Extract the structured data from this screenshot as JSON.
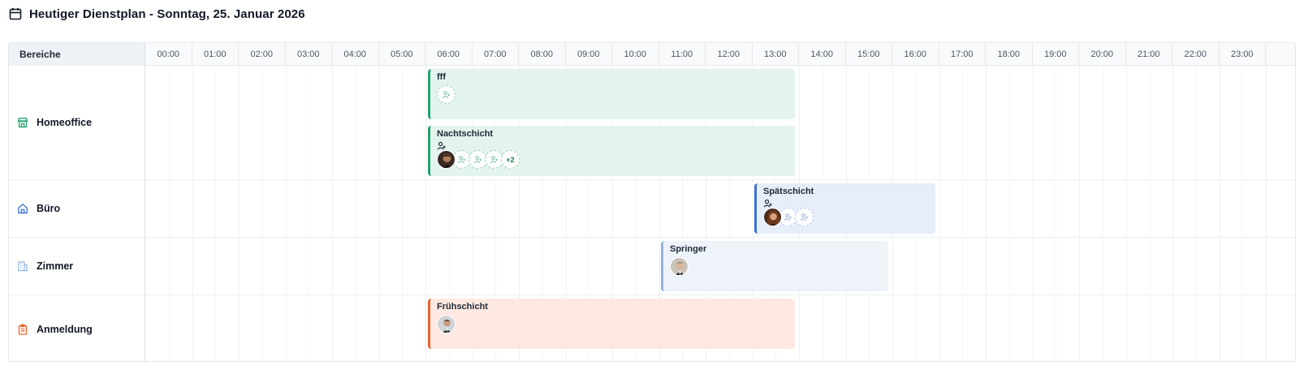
{
  "header": {
    "title": "Heutiger Dienstplan - Sonntag, 25. Januar 2026",
    "icon": "calendar-icon"
  },
  "grid": {
    "areas_header": "Bereiche",
    "hours": [
      "00:00",
      "01:00",
      "02:00",
      "03:00",
      "04:00",
      "05:00",
      "06:00",
      "07:00",
      "08:00",
      "09:00",
      "10:00",
      "11:00",
      "12:00",
      "13:00",
      "14:00",
      "15:00",
      "16:00",
      "17:00",
      "18:00",
      "19:00",
      "20:00",
      "21:00",
      "22:00",
      "23:00"
    ]
  },
  "rows": [
    {
      "label": "Homeoffice",
      "icon": "store-icon",
      "color": "#22a06b"
    },
    {
      "label": "Büro",
      "icon": "home-icon",
      "color": "#3b6fd8"
    },
    {
      "label": "Zimmer",
      "icon": "building-icon",
      "color": "#93b4e0"
    },
    {
      "label": "Anmeldung",
      "icon": "clipboard-icon",
      "color": "#e8622d"
    }
  ],
  "shifts": {
    "fff": {
      "name": "fff",
      "start": "06:00",
      "end": "14:00"
    },
    "nachtschicht": {
      "name": "Nachtschicht",
      "start": "06:00",
      "end": "14:00",
      "more_count": "+2"
    },
    "spaetschicht": {
      "name": "Spätschicht",
      "start": "13:00",
      "end": "17:00"
    },
    "springer": {
      "name": "Springer",
      "start": "11:00",
      "end": "16:00"
    },
    "fruehschicht": {
      "name": "Frühschicht",
      "start": "06:00",
      "end": "14:00"
    }
  },
  "colors": {
    "green": "#22a06b",
    "blue": "#3b6fd8",
    "lightblue": "#93b4e0",
    "orange": "#e8622d"
  }
}
